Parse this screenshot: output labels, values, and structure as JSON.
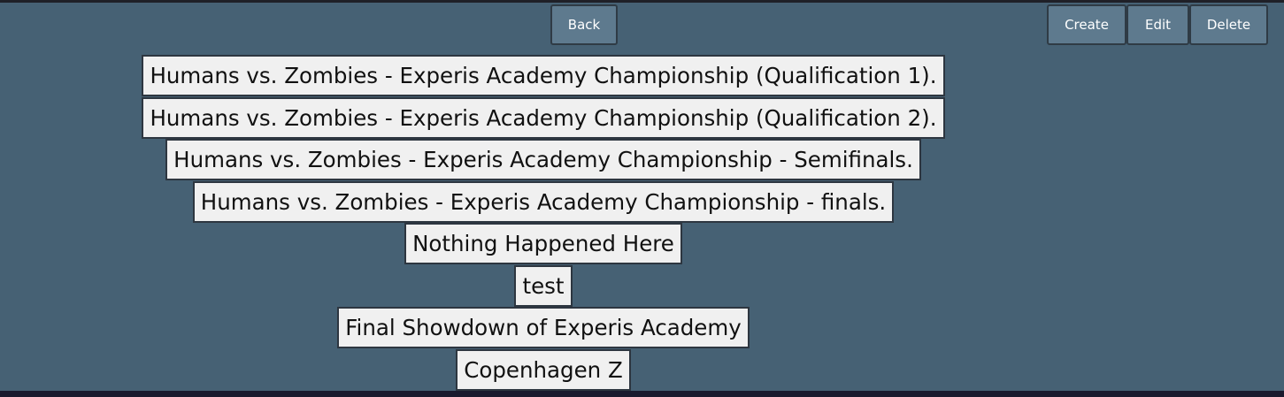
{
  "toolbar": {
    "back_label": "Back",
    "create_label": "Create",
    "edit_label": "Edit",
    "delete_label": "Delete"
  },
  "games": [
    "Humans vs. Zombies - Experis Academy Championship (Qualification 1).",
    "Humans vs. Zombies - Experis Academy Championship (Qualification 2).",
    "Humans vs. Zombies - Experis Academy Championship - Semifinals.",
    "Humans vs. Zombies - Experis Academy Championship - finals.",
    "Nothing Happened Here",
    "test",
    "Final Showdown of Experis Academy",
    "Copenhagen Z"
  ],
  "colors": {
    "background": "#466174",
    "button": "#5e7a8e",
    "item_background": "#f0f0f0",
    "border": "#2d3640"
  }
}
